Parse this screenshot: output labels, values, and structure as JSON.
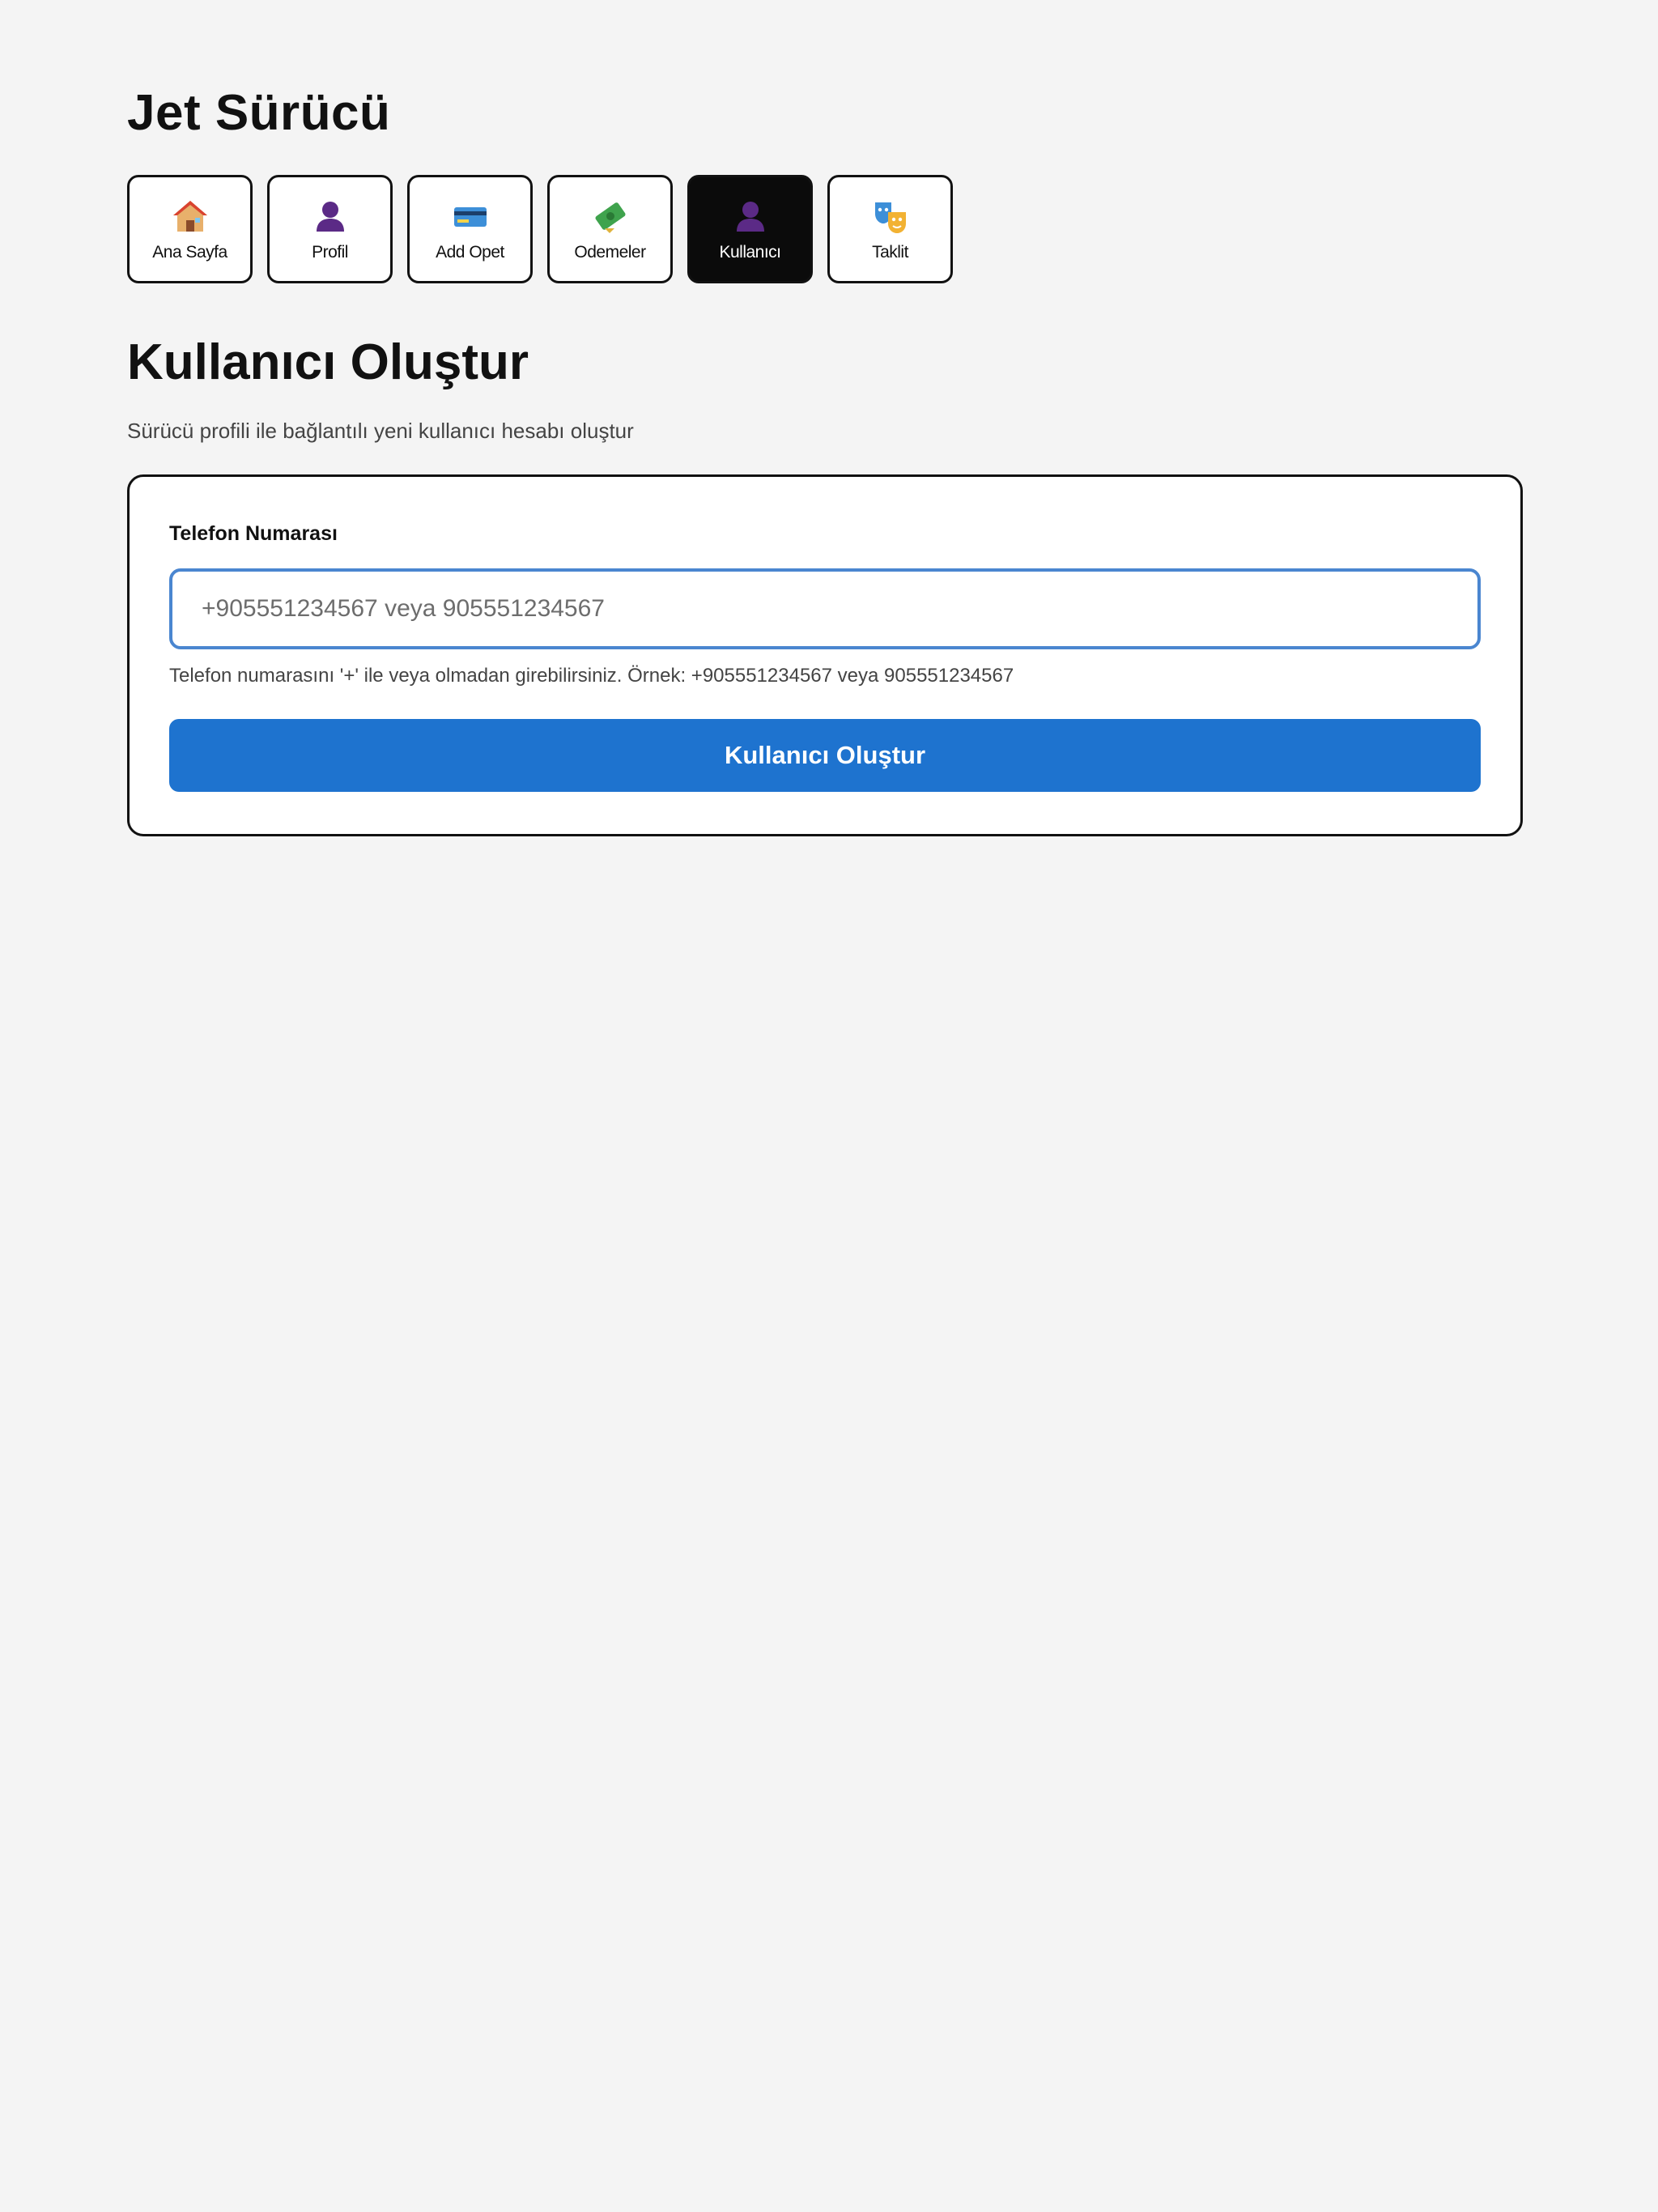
{
  "app": {
    "title": "Jet Sürücü"
  },
  "nav": {
    "items": [
      {
        "label": "Ana Sayfa",
        "icon": "house-icon",
        "active": false
      },
      {
        "label": "Profil",
        "icon": "user-icon",
        "active": false
      },
      {
        "label": "Add Opet",
        "icon": "credit-card-icon",
        "active": false
      },
      {
        "label": "Odemeler",
        "icon": "money-icon",
        "active": false
      },
      {
        "label": "Kullanıcı",
        "icon": "user-icon",
        "active": true
      },
      {
        "label": "Taklit",
        "icon": "theater-masks-icon",
        "active": false
      }
    ]
  },
  "section": {
    "title": "Kullanıcı Oluştur",
    "subtitle": "Sürücü profili ile bağlantılı yeni kullanıcı hesabı oluştur"
  },
  "form": {
    "phone_label": "Telefon Numarası",
    "phone_value": "",
    "phone_placeholder": "+905551234567 veya 905551234567",
    "phone_help": "Telefon numarasını '+' ile veya olmadan girebilirsiniz. Örnek: +905551234567 veya 905551234567",
    "submit_label": "Kullanıcı Oluştur"
  },
  "colors": {
    "background": "#f4f4f4",
    "active_tab": "#0b0b0b",
    "primary_button": "#1e73cf",
    "input_focus_border": "#4a86d0",
    "user_icon": "#5b2a86"
  }
}
